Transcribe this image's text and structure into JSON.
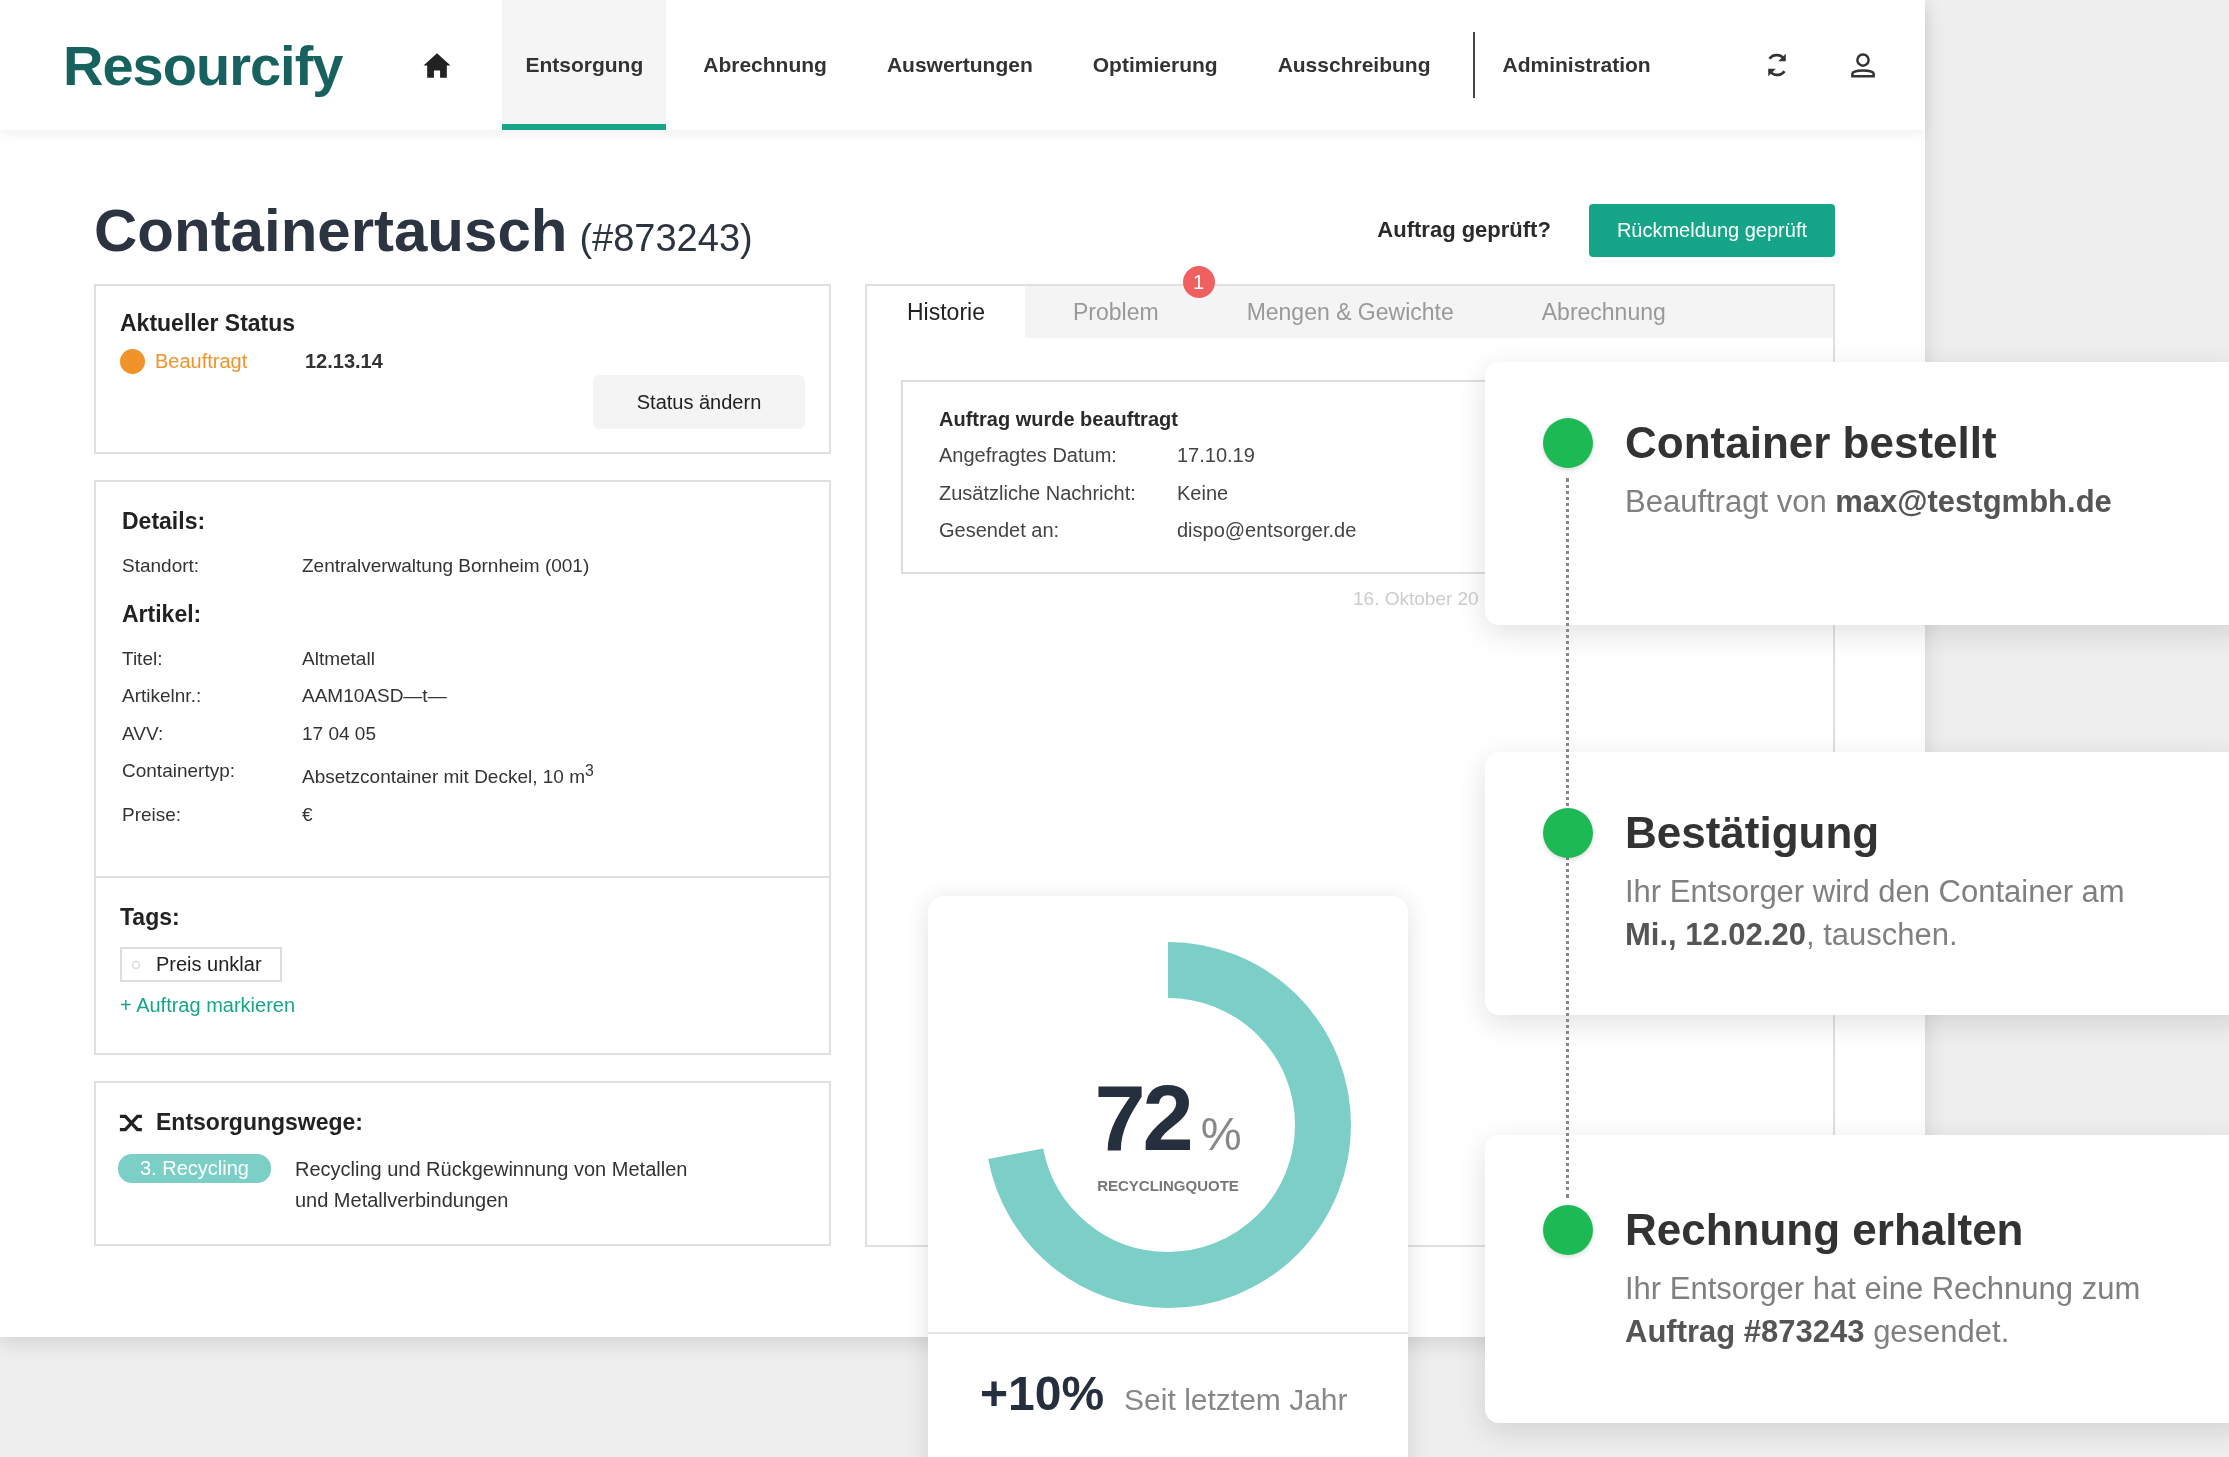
{
  "logo": "Resourcify",
  "nav": [
    {
      "label": "Entsorgung",
      "selected": true
    },
    {
      "label": "Abrechnung",
      "selected": false
    },
    {
      "label": "Auswertungen",
      "selected": false
    },
    {
      "label": "Optimierung",
      "selected": false
    },
    {
      "label": "Ausschreibung",
      "selected": false
    }
  ],
  "admin_link": "Administration",
  "page": {
    "title": "Containertausch",
    "number": "(#873243)",
    "check_label": "Auftrag geprüft?",
    "check_button": "Rückmeldung geprüft"
  },
  "status": {
    "heading": "Aktueller Status",
    "state": "Beauftragt",
    "color": "#f0932b",
    "code": "12.13.14",
    "button": "Status ändern"
  },
  "details": {
    "heading": "Details:",
    "rows": [
      {
        "label": "Standort:",
        "value": "Zentralverwaltung Bornheim (001)"
      }
    ],
    "article_heading": "Artikel:",
    "article_rows": [
      {
        "label": "Titel:",
        "value": "Altmetall"
      },
      {
        "label": "Artikelnr.:",
        "value": "AAM10ASD—t—"
      },
      {
        "label": "AVV:",
        "value": "17 04 05"
      },
      {
        "label": "Containertyp:",
        "value": "Absetzcontainer mit Deckel, 10 m$^{3}$"
      },
      {
        "label": "Preise:",
        "value": "€"
      }
    ]
  },
  "tags": {
    "heading": "Tags:",
    "items": [
      "Preis unklar"
    ],
    "add_link": "+ Auftrag markieren"
  },
  "routes": {
    "heading": "Entsorgungswege:",
    "items": [
      {
        "tag": "3. Recycling",
        "text": "Recycling und Rückgewinnung von Metallen und Metallverbindungen"
      }
    ]
  },
  "tabs": [
    {
      "label": "Historie",
      "selected": true
    },
    {
      "label": "Problem",
      "selected": false,
      "badge": "1"
    },
    {
      "label": "Mengen & Gewichte",
      "selected": false
    },
    {
      "label": "Abrechnung",
      "selected": false
    }
  ],
  "history": {
    "heading": "Auftrag wurde beauftragt",
    "rows": [
      {
        "label": "Angefragtes Datum:",
        "value": "17.10.19"
      },
      {
        "label": "Zusätzliche Nachricht:",
        "value": "Keine"
      },
      {
        "label": "Gesendet an:",
        "value": "dispo@entsorger.de"
      }
    ],
    "timestamp": "16. Oktober 20"
  },
  "recycling": {
    "value": "72",
    "unit": "%",
    "label": "RECYCLINGQUOTE",
    "level": 0.72,
    "change": "+10%",
    "change_label": "Seit letztem Jahr"
  },
  "timeline": [
    {
      "title": "Container bestellt",
      "text": "Beauftragt von **max@testgmbh.de**",
      "done": true
    },
    {
      "title": "Bestätigung",
      "text": "Ihr Entsorger wird den Container am **Mi., 12.02.20**, tauschen.",
      "done": true
    },
    {
      "title": "Rechnung erhalten",
      "text": "Ihr Entsorger hat eine Rechnung zum **Auftrag #873243** gesendet.",
      "done": true
    }
  ]
}
